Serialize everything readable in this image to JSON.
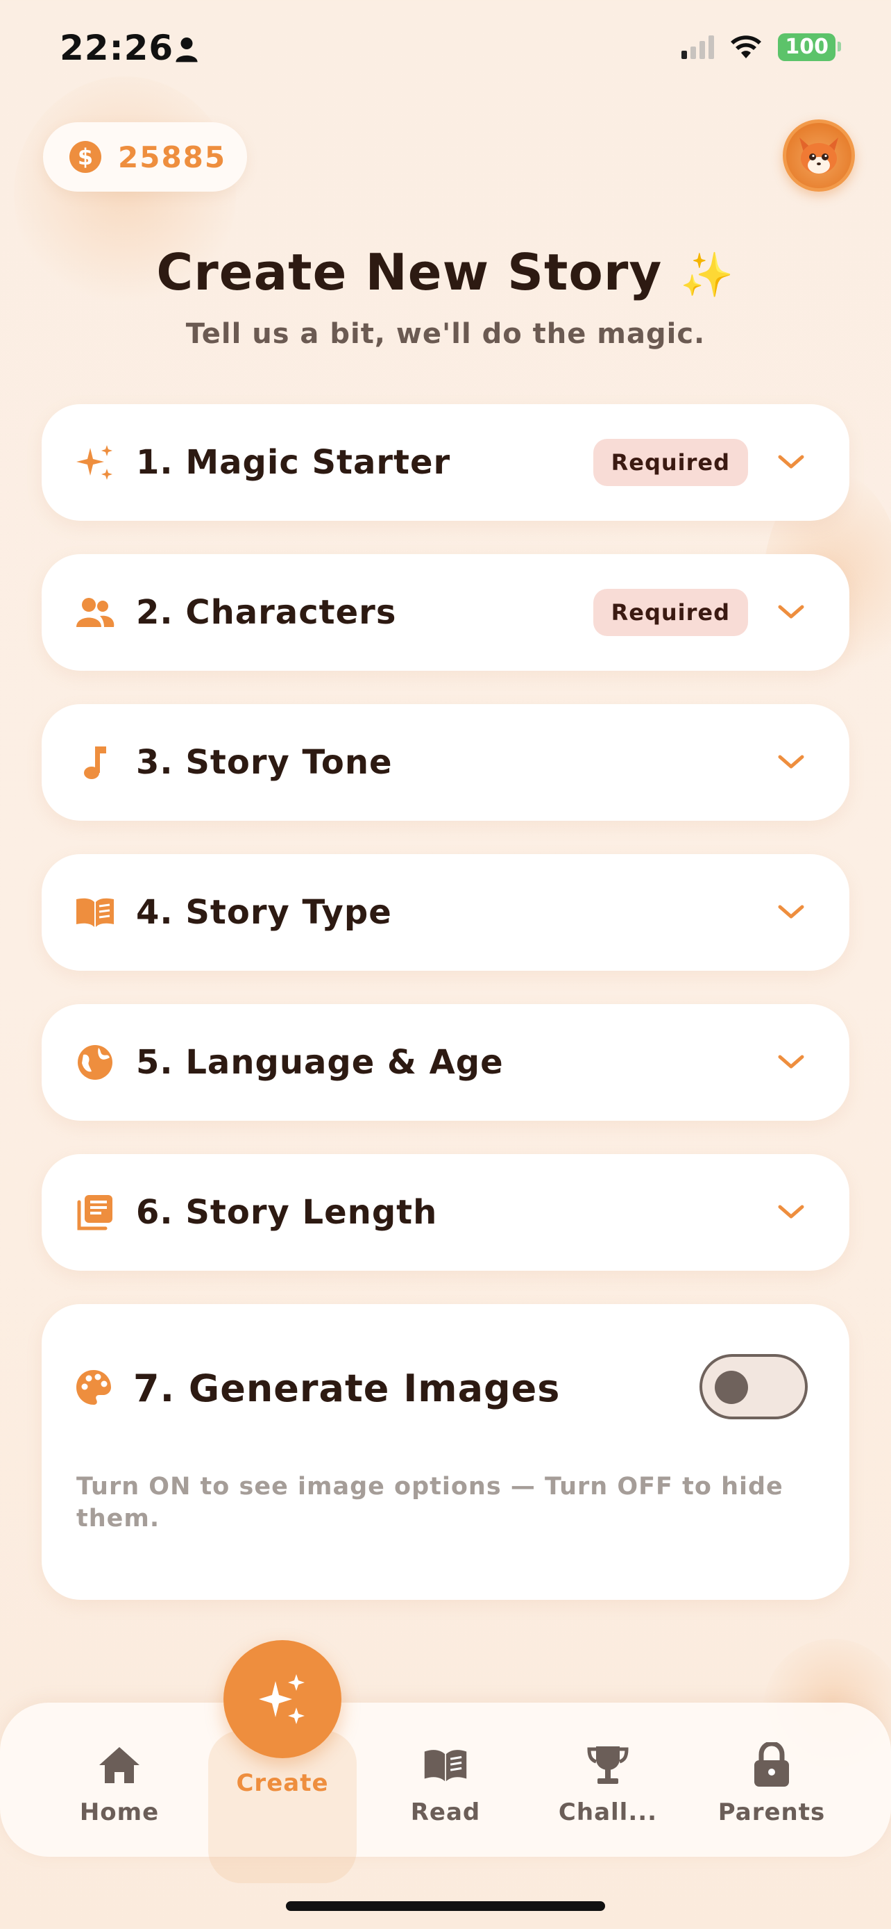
{
  "status_bar": {
    "time": "22:26",
    "battery": "100",
    "icons": [
      "person-icon",
      "signal-icon",
      "wifi-icon",
      "battery-icon"
    ]
  },
  "header": {
    "coins": "25885",
    "coin_icon": "dollar-coin-icon",
    "avatar_icon": "fox-avatar-icon"
  },
  "page": {
    "title": "Create New Story",
    "title_emoji": "✨",
    "subtitle": "Tell us a bit, we'll do the magic."
  },
  "sections": [
    {
      "label": "1. Magic Starter",
      "icon": "sparkles-icon",
      "badge": "Required"
    },
    {
      "label": "2. Characters",
      "icon": "people-icon",
      "badge": "Required"
    },
    {
      "label": "3. Story Tone",
      "icon": "music-note-icon",
      "badge": ""
    },
    {
      "label": "4. Story Type",
      "icon": "open-book-icon",
      "badge": ""
    },
    {
      "label": "5. Language & Age",
      "icon": "globe-icon",
      "badge": ""
    },
    {
      "label": "6. Story Length",
      "icon": "article-icon",
      "badge": ""
    }
  ],
  "images_section": {
    "label": "7. Generate Images",
    "icon": "palette-icon",
    "toggle_on": false,
    "description": "Turn ON to see image options — Turn OFF to hide them."
  },
  "bottom_nav": [
    {
      "label": "Home",
      "icon": "home-icon"
    },
    {
      "label": "Create",
      "icon": "sparkles-icon",
      "active": true
    },
    {
      "label": "Read",
      "icon": "book-icon"
    },
    {
      "label": "Chall...",
      "icon": "trophy-icon"
    },
    {
      "label": "Parents",
      "icon": "lock-icon"
    }
  ],
  "colors": {
    "accent": "#ee8e3e",
    "background": "#fbeee3",
    "text": "#2d1a12",
    "badge_bg": "#f8dcd6"
  }
}
